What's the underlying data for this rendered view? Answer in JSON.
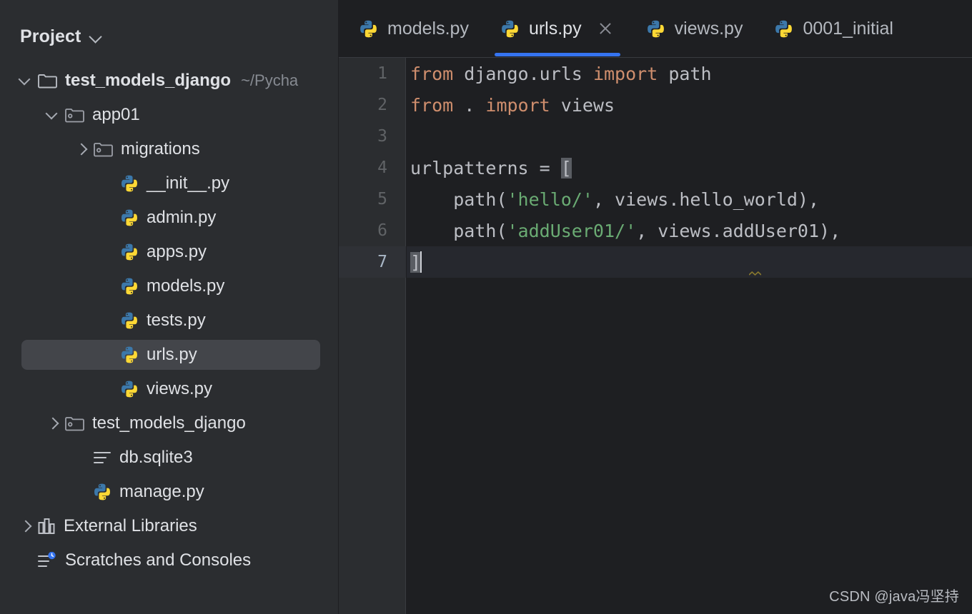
{
  "sidebar": {
    "header": {
      "title": "Project",
      "chevron_icon": "chevron-down-icon"
    },
    "tree": [
      {
        "label": "test_models_django",
        "sub": "~/Pycha",
        "icon": "folder-icon",
        "arrow": "expanded",
        "depth": 0,
        "bold": true,
        "selected": false
      },
      {
        "label": "app01",
        "sub": "",
        "icon": "module-folder-icon",
        "arrow": "expanded",
        "depth": 1,
        "bold": false,
        "selected": false
      },
      {
        "label": "migrations",
        "sub": "",
        "icon": "module-folder-icon",
        "arrow": "collapsed",
        "depth": 2,
        "bold": false,
        "selected": false
      },
      {
        "label": "__init__.py",
        "sub": "",
        "icon": "python-file-icon",
        "arrow": "none",
        "depth": 3,
        "bold": false,
        "selected": false
      },
      {
        "label": "admin.py",
        "sub": "",
        "icon": "python-file-icon",
        "arrow": "none",
        "depth": 3,
        "bold": false,
        "selected": false
      },
      {
        "label": "apps.py",
        "sub": "",
        "icon": "python-file-icon",
        "arrow": "none",
        "depth": 3,
        "bold": false,
        "selected": false
      },
      {
        "label": "models.py",
        "sub": "",
        "icon": "python-file-icon",
        "arrow": "none",
        "depth": 3,
        "bold": false,
        "selected": false
      },
      {
        "label": "tests.py",
        "sub": "",
        "icon": "python-file-icon",
        "arrow": "none",
        "depth": 3,
        "bold": false,
        "selected": false
      },
      {
        "label": "urls.py",
        "sub": "",
        "icon": "python-file-icon",
        "arrow": "none",
        "depth": 3,
        "bold": false,
        "selected": true
      },
      {
        "label": "views.py",
        "sub": "",
        "icon": "python-file-icon",
        "arrow": "none",
        "depth": 3,
        "bold": false,
        "selected": false
      },
      {
        "label": "test_models_django",
        "sub": "",
        "icon": "module-folder-icon",
        "arrow": "collapsed",
        "depth": 1,
        "bold": false,
        "selected": false
      },
      {
        "label": "db.sqlite3",
        "sub": "",
        "icon": "text-file-icon",
        "arrow": "none",
        "depth": 2,
        "bold": false,
        "selected": false
      },
      {
        "label": "manage.py",
        "sub": "",
        "icon": "python-file-icon",
        "arrow": "none",
        "depth": 2,
        "bold": false,
        "selected": false
      },
      {
        "label": "External Libraries",
        "sub": "",
        "icon": "library-icon",
        "arrow": "collapsed",
        "depth": 0,
        "bold": false,
        "selected": false
      },
      {
        "label": "Scratches and Consoles",
        "sub": "",
        "icon": "scratches-icon",
        "arrow": "none",
        "depth": 0,
        "bold": false,
        "selected": false
      }
    ]
  },
  "editor": {
    "tabs": [
      {
        "label": "models.py",
        "icon": "python-file-icon",
        "active": false,
        "closable": false
      },
      {
        "label": "urls.py",
        "icon": "python-file-icon",
        "active": true,
        "closable": true
      },
      {
        "label": "views.py",
        "icon": "python-file-icon",
        "active": false,
        "closable": false
      },
      {
        "label": "0001_initial",
        "icon": "python-file-icon",
        "active": false,
        "closable": false
      }
    ],
    "active_tab": "urls.py",
    "line_numbers": [
      "1",
      "2",
      "3",
      "4",
      "5",
      "6",
      "7"
    ],
    "lines": [
      {
        "n": "1",
        "text": "from django.urls import path"
      },
      {
        "n": "2",
        "text": "from . import views"
      },
      {
        "n": "3",
        "text": ""
      },
      {
        "n": "4",
        "text": "urlpatterns = ["
      },
      {
        "n": "5",
        "text": "    path('hello/', views.hello_world),"
      },
      {
        "n": "6",
        "text": "    path('addUser01/', views.addUser01),"
      },
      {
        "n": "7",
        "text": "]"
      }
    ],
    "cursor_line": "7",
    "colors": {
      "keyword": "#cf8e6d",
      "string": "#6aab73",
      "identifier": "#bcbec4",
      "editor_bg": "#1e1f22",
      "gutter_bg": "#2b2d30",
      "sidebar_bg": "#2b2d30",
      "selection": "#43454a",
      "accent": "#3574f0"
    }
  },
  "watermark": {
    "text": "CSDN @java冯坚持"
  }
}
